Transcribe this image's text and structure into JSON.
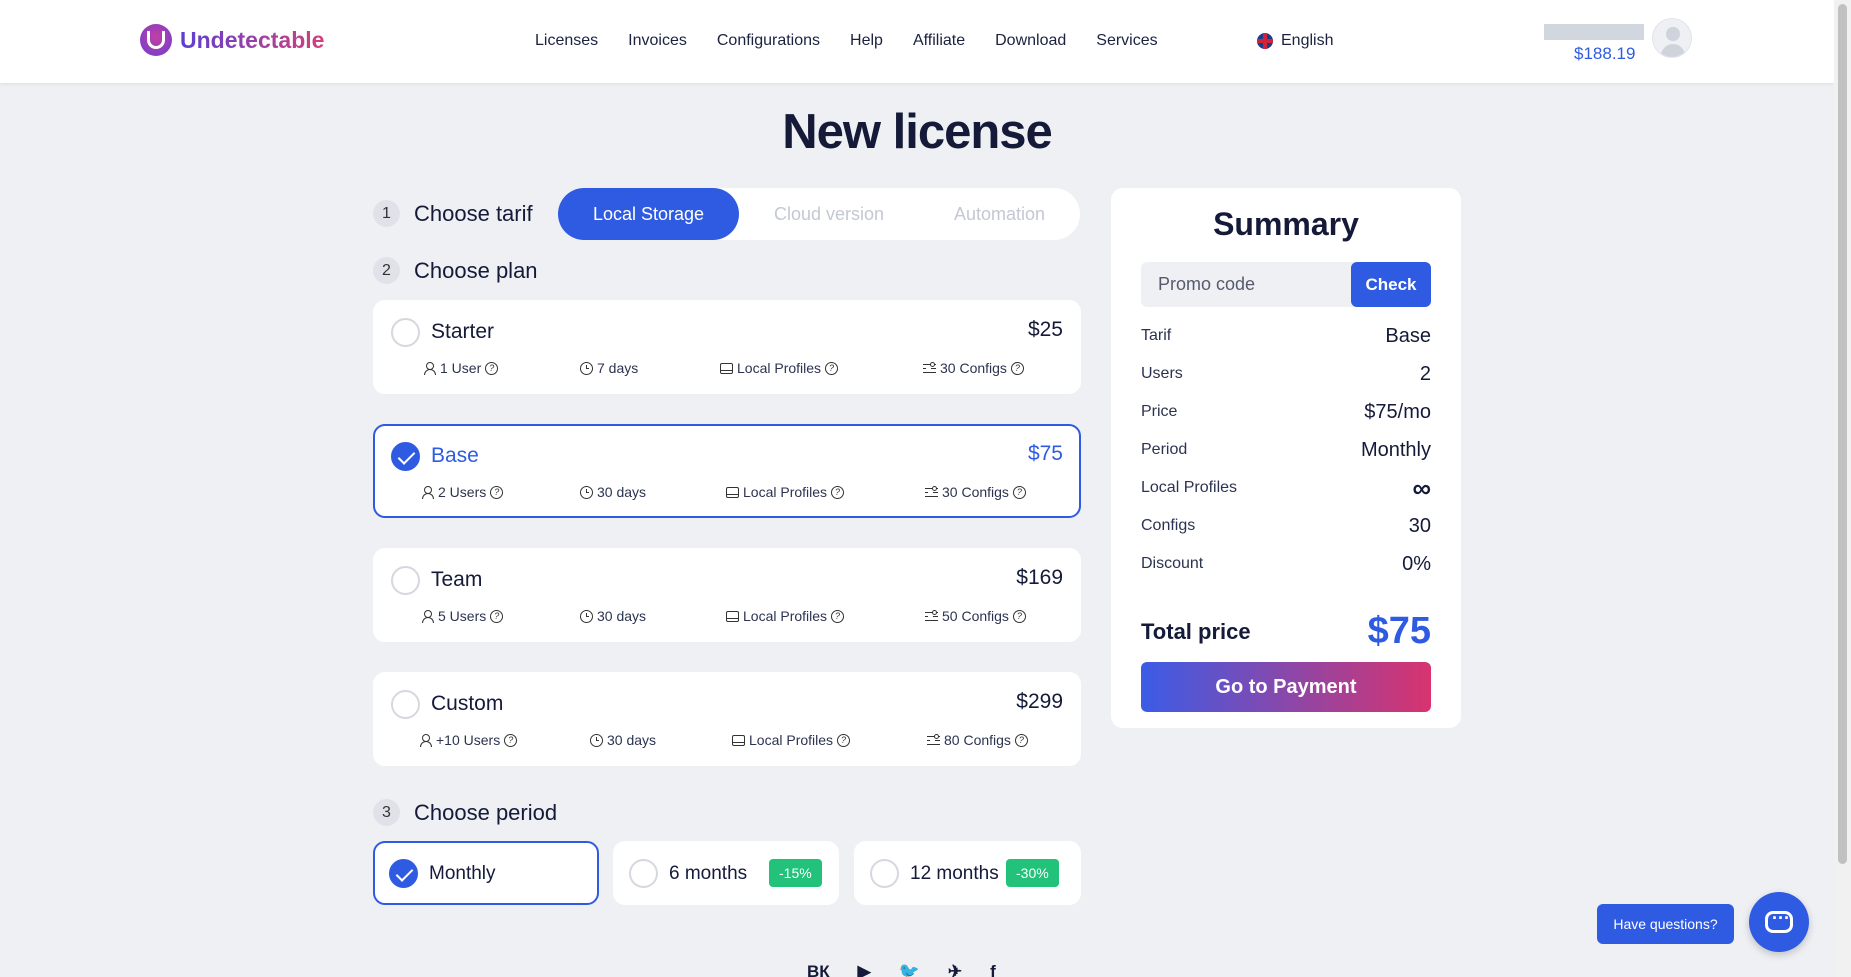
{
  "header": {
    "logo_text": "Undetectable",
    "nav": [
      "Licenses",
      "Invoices",
      "Configurations",
      "Help",
      "Affiliate",
      "Download",
      "Services"
    ],
    "language": "English",
    "balance": "$188.19"
  },
  "page_title": "New license",
  "steps": {
    "tarif": {
      "num": "1",
      "label": "Choose tarif"
    },
    "plan": {
      "num": "2",
      "label": "Choose plan"
    },
    "period": {
      "num": "3",
      "label": "Choose period"
    }
  },
  "tarif_tabs": [
    {
      "label": "Local Storage",
      "active": true
    },
    {
      "label": "Cloud version",
      "active": false
    },
    {
      "label": "Automation",
      "active": false
    }
  ],
  "plans": [
    {
      "name": "Starter",
      "price": "$25",
      "users": "1 User",
      "days": "7 days",
      "profiles": "Local Profiles",
      "configs": "30 Configs",
      "selected": false
    },
    {
      "name": "Base",
      "price": "$75",
      "users": "2 Users",
      "days": "30 days",
      "profiles": "Local Profiles",
      "configs": "30 Configs",
      "selected": true
    },
    {
      "name": "Team",
      "price": "$169",
      "users": "5 Users",
      "days": "30 days",
      "profiles": "Local Profiles",
      "configs": "50 Configs",
      "selected": false
    },
    {
      "name": "Custom",
      "price": "$299",
      "users": "+10 Users",
      "days": "30 days",
      "profiles": "Local Profiles",
      "configs": "80 Configs",
      "selected": false
    }
  ],
  "periods": [
    {
      "label": "Monthly",
      "discount": "",
      "selected": true
    },
    {
      "label": "6 months",
      "discount": "-15%",
      "selected": false
    },
    {
      "label": "12 months",
      "discount": "-30%",
      "selected": false
    }
  ],
  "summary": {
    "title": "Summary",
    "promo_placeholder": "Promo code",
    "check_label": "Check",
    "rows": [
      {
        "key": "Tarif",
        "value": "Base"
      },
      {
        "key": "Users",
        "value": "2"
      },
      {
        "key": "Price",
        "value": "$75/mo"
      },
      {
        "key": "Period",
        "value": "Monthly"
      },
      {
        "key": "Local Profiles",
        "value": "∞"
      },
      {
        "key": "Configs",
        "value": "30"
      },
      {
        "key": "Discount",
        "value": "0%"
      }
    ],
    "total_label": "Total price",
    "total_value": "$75",
    "pay_label": "Go to Payment"
  },
  "social": [
    "ВК",
    "▶",
    "🐦",
    "✈",
    "f"
  ],
  "chat": {
    "tooltip": "Have questions?"
  },
  "colors": {
    "accent": "#2f5be3",
    "discount": "#22c27a"
  }
}
